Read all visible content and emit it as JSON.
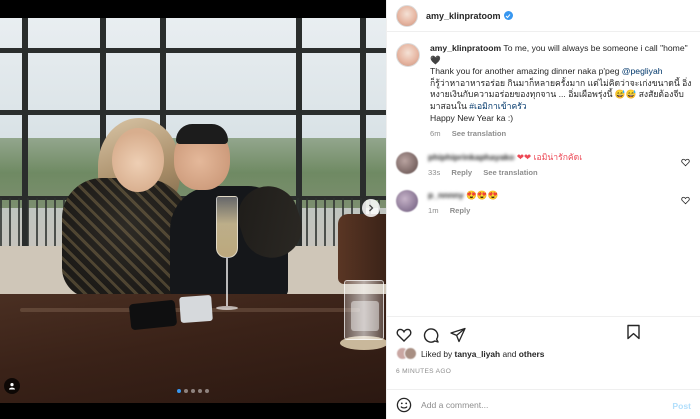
{
  "post": {
    "username": "amy_klinpratoom",
    "verified": true
  },
  "caption": {
    "username": "amy_klinpratoom",
    "line1": "To me, you will always be someone i call \"home\" 🖤",
    "line2_pre": "Thank you for another amazing dinner naka p'peg ",
    "mention": "@pegliyah",
    "line3": "ก็รู้ว่าหาอาหารอร่อย กินมาก็หลายครั้งมาก แต่ไม่คิดว่าจะเก่งขนาดนี้ อิ่ง หงายเงินกับความอร่อยของทุกจาน ... อิ่มเผือพรุ่งนี้ 😅😅 สงสัยต้องจีบมาสอนใน ",
    "hashtag": "#เอมิกาเข้าครัว",
    "line4": "Happy New Year ka :)",
    "time": "6m",
    "see_translation": "See translation"
  },
  "comments": [
    {
      "username": "phiphiprinkaphayako",
      "text": "❤❤ เอมิน่ารักคัดเ",
      "time": "33s",
      "reply": "Reply",
      "see_translation": "See translation"
    },
    {
      "username": "p_nnnny",
      "text": "😍😍😍",
      "time": "1m",
      "reply": "Reply"
    }
  ],
  "likes": {
    "prefix": "Liked by ",
    "user": "tanya_liyah",
    "mid": " and ",
    "others": "others"
  },
  "timestamp": "6 MINUTES AGO",
  "add_comment": {
    "placeholder": "Add a comment...",
    "post_label": "Post"
  },
  "carousel": {
    "total": 5,
    "active_index": 0
  },
  "colors": {
    "verified_blue": "#3897f0",
    "link_blue": "#00376b",
    "like_red": "#ed4956",
    "post_disabled": "#b2dffc"
  }
}
